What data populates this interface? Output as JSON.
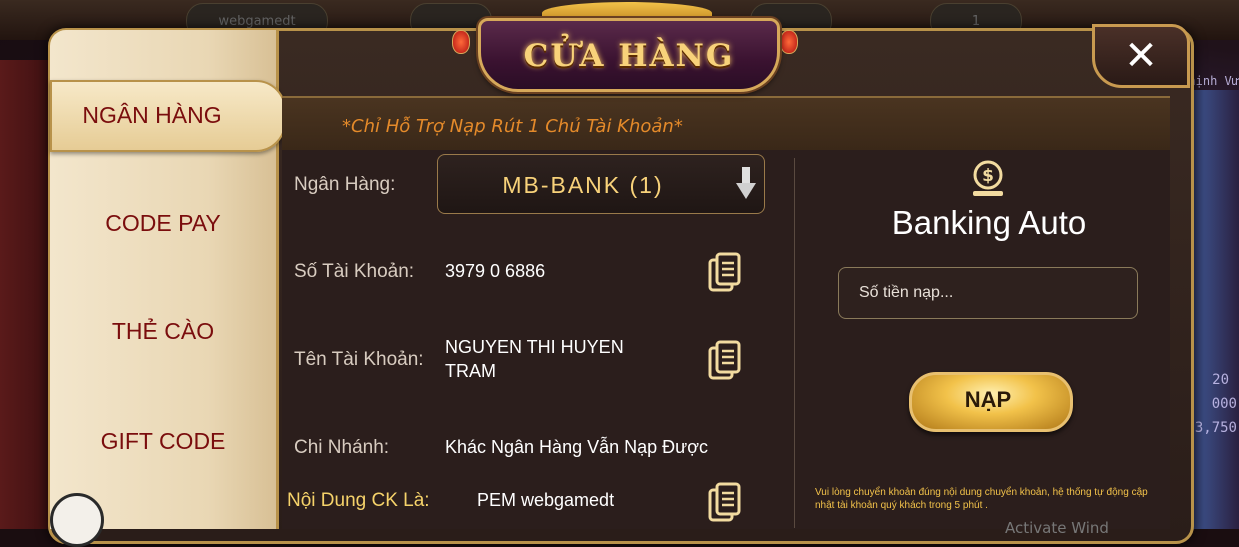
{
  "title": "CỬA HÀNG",
  "top_bar": {
    "username": "webgamedt",
    "count": "1"
  },
  "sidebar": {
    "items": [
      {
        "label": "NGÂN HÀNG",
        "active": true
      },
      {
        "label": "CODE PAY",
        "active": false
      },
      {
        "label": "THẺ CÀO",
        "active": false
      },
      {
        "label": "GIFT CODE",
        "active": false
      }
    ]
  },
  "notice": "*Chỉ Hỗ Trợ Nạp Rút 1 Chủ Tài Khoản*",
  "form": {
    "bank_label": "Ngân Hàng:",
    "bank_value": "MB-BANK (1)",
    "account_number_label": "Số Tài Khoản:",
    "account_number": "3979 0 6886",
    "account_name_label": "Tên Tài Khoản:",
    "account_name_line1": "NGUYEN THI HUYEN",
    "account_name_line2": "TRAM",
    "branch_label": "Chi Nhánh:",
    "branch_value": "Khác Ngân Hàng Vẫn Nạp Được",
    "content_label": "Nội Dung CK Là:",
    "content_value": "PEM webgamedt"
  },
  "banking_auto": {
    "title": "Banking Auto",
    "amount_placeholder": "Số tiền nạp...",
    "submit_label": "NẠP",
    "note": "Vui lòng chuyển khoản đúng nội dung chuyển khoản, hệ thống tự động cập nhật tài khoản quý khách trong 5 phút ."
  },
  "background": {
    "right_numbers": [
      "20",
      "000",
      "3,750"
    ],
    "right_text": "Thịnh Vư",
    "watermark": "Activate Wind"
  },
  "colors": {
    "accent_gold": "#f8d27a",
    "sidebar_text": "#7a0d0d",
    "notice": "#e48a2a"
  }
}
